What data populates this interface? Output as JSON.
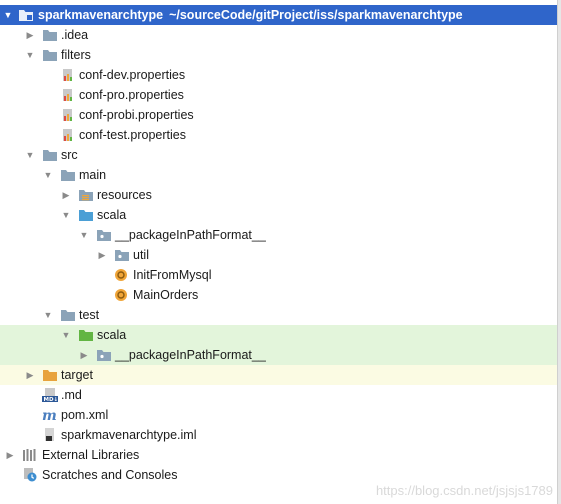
{
  "project": {
    "name": "sparkmavenarchtype",
    "path": "~/sourceCode/gitProject/iss/sparkmavenarchtype"
  },
  "tree": {
    "idea": ".idea",
    "filters": "filters",
    "conf_dev": "conf-dev.properties",
    "conf_pro": "conf-pro.properties",
    "conf_probi": "conf-probi.properties",
    "conf_test": "conf-test.properties",
    "src": "src",
    "main": "main",
    "resources": "resources",
    "scala_main": "scala",
    "package_main": "__packageInPathFormat__",
    "util": "util",
    "init_from_mysql": "InitFromMysql",
    "main_orders": "MainOrders",
    "test": "test",
    "scala_test": "scala",
    "package_test": "__packageInPathFormat__",
    "target": "target",
    "md": ".md",
    "pom": "pom.xml",
    "iml": "sparkmavenarchtype.iml",
    "external_libraries": "External Libraries",
    "scratches": "Scratches and Consoles"
  },
  "watermark": "https://blog.csdn.net/jsjsjs1789",
  "colors": {
    "selection": "#2f65ca",
    "test_scope_highlight": "#e3f5db",
    "excluded_highlight": "#fbfbe3",
    "folder": "#8ba3b8",
    "source_folder": "#4b9fd5",
    "test_folder": "#62b543",
    "excluded_folder": "#e8a33d",
    "class_icon": "#f0a63a"
  },
  "icons": {
    "collapsed_arrow": "triangle-right",
    "expanded_arrow": "triangle-down",
    "folder": "folder-icon",
    "properties": "properties-file-icon",
    "class": "class-icon",
    "maven": "maven-icon",
    "markdown": "markdown-icon",
    "iml": "iml-file-icon",
    "libraries": "external-libraries-icon",
    "scratches": "scratches-icon"
  }
}
